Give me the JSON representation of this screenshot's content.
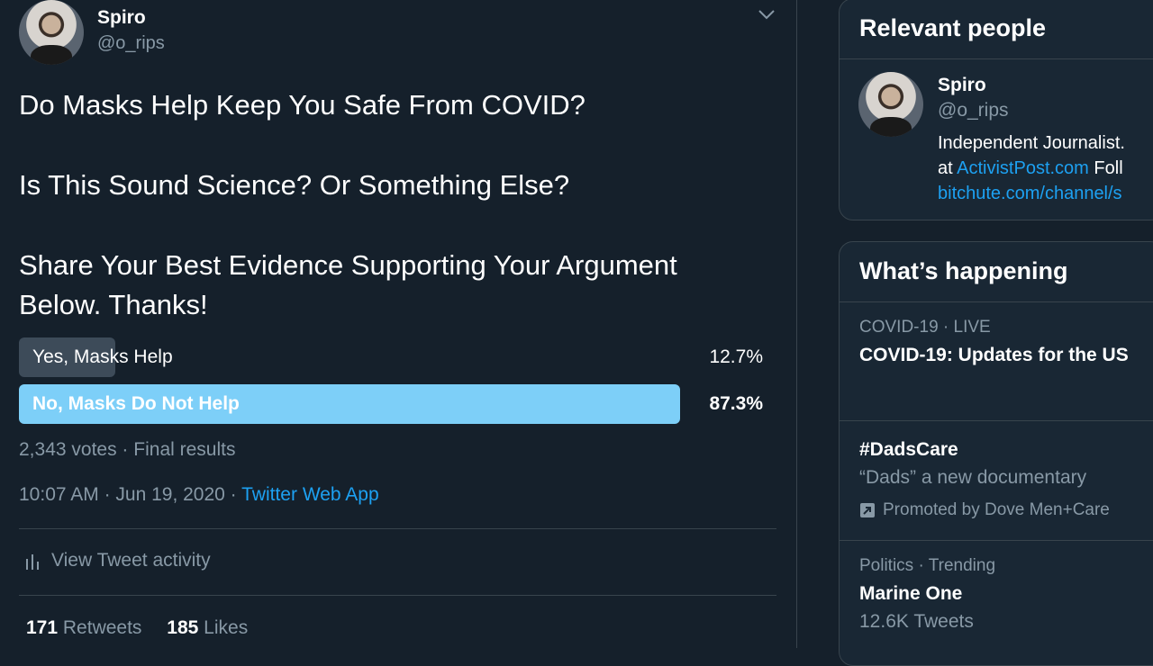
{
  "tweet": {
    "author_name": "Spiro",
    "author_handle": "@o_rips",
    "text_line1": "Do Masks Help Keep You Safe From COVID?",
    "text_line2": "Is This Sound Science? Or Something Else?",
    "text_line3": "Share Your Best Evidence Supporting Your Argument",
    "text_line4": "Below. Thanks!",
    "poll": {
      "options": [
        {
          "label": "Yes, Masks Help",
          "percent_text": "12.7%",
          "percent": 12.7
        },
        {
          "label": "No, Masks Do Not Help",
          "percent_text": "87.3%",
          "percent": 87.3
        }
      ],
      "votes": "2,343 votes",
      "status": "Final results"
    },
    "time": "10:07 AM",
    "date": "Jun 19, 2020",
    "source": "Twitter Web App",
    "activity_label": "View Tweet activity",
    "retweets_count": "171",
    "retweets_label": "Retweets",
    "likes_count": "185",
    "likes_label": "Likes"
  },
  "relevant_people": {
    "title": "Relevant people",
    "name": "Spiro",
    "handle": "@o_rips",
    "bio_line1": "Independent Journalist.",
    "bio_line2_prefix": "at",
    "bio_line2_link": "ActivistPost.com",
    "bio_line2_suffix": "Foll",
    "bio_line3_link": "bitchute.com/channel/s"
  },
  "whats_happening": {
    "title": "What’s happening",
    "trends": [
      {
        "context": "COVID-19 · LIVE",
        "title": "COVID-19: Updates for the US"
      },
      {
        "title": "#DadsCare",
        "description": "“Dads” a new documentary",
        "promoted": "Promoted by Dove Men+Care"
      },
      {
        "context": "Politics · Trending",
        "title": "Marine One",
        "tweets": "12.6K Tweets"
      }
    ]
  },
  "colors": {
    "background": "#15202b",
    "accent": "#1da1f2",
    "winning_bar": "#7dcff8",
    "losing_bar": "#3d4b59",
    "secondary_text": "#8899a6"
  }
}
